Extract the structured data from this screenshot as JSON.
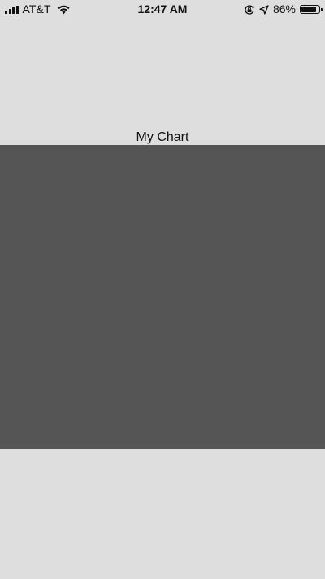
{
  "status_bar": {
    "carrier": "AT&T",
    "time": "12:47 AM",
    "battery_percent": "86%",
    "battery_level": 0.86,
    "signal_bars": 4,
    "icons": [
      "signal-icon",
      "wifi-icon",
      "rotation-lock-icon",
      "location-arrow-icon",
      "battery-icon"
    ]
  },
  "chart": {
    "title": "My Chart",
    "background_color": "#555555"
  },
  "page": {
    "background_color": "#dedede"
  }
}
